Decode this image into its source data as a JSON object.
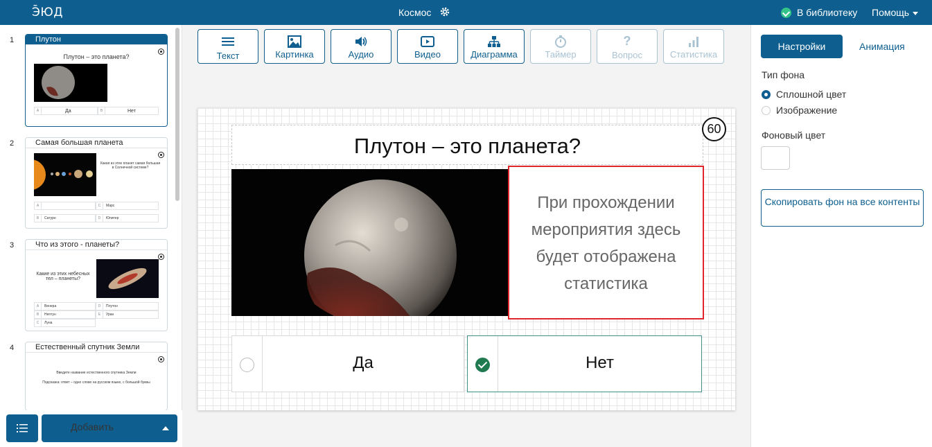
{
  "topbar": {
    "logo": "Э̄ЮД",
    "title": "Космос",
    "library": "В библиотеку",
    "help": "Помощь"
  },
  "slides": [
    {
      "num": "1",
      "title": "Плутон",
      "question": "Плутон – это планета?",
      "answers": [
        {
          "l": "A",
          "t": "Да"
        },
        {
          "l": "B",
          "t": "Нет"
        }
      ]
    },
    {
      "num": "2",
      "title": "Самая большая планета",
      "question": "Какая из этих планет самая большая в Солнечной системе?",
      "answers": [
        {
          "l": "A",
          "t": ""
        },
        {
          "l": "C",
          "t": "Марс"
        },
        {
          "l": "B",
          "t": "Сатурн"
        },
        {
          "l": "D",
          "t": "Юпитер"
        }
      ]
    },
    {
      "num": "3",
      "title": "Что из этого - планеты?",
      "question": "Какие из этих небесных тел – планеты?",
      "answers": [
        {
          "l": "A",
          "t": "Венера"
        },
        {
          "l": "D",
          "t": "Плутон"
        },
        {
          "l": "B",
          "t": "Нептун"
        },
        {
          "l": "E",
          "t": "Уран"
        },
        {
          "l": "C",
          "t": "Луна"
        }
      ]
    },
    {
      "num": "4",
      "title": "Естественный спутник Земли",
      "question": "Введите название естественного спутника Земли",
      "hint": "Подсказка: ответ – одно слово на русском языке, с большой буквы"
    }
  ],
  "left_bottom": {
    "add": "Добавить"
  },
  "toolbar": [
    {
      "icon": "text-icon",
      "label": "Текст",
      "enabled": true
    },
    {
      "icon": "image-icon",
      "label": "Картинка",
      "enabled": true
    },
    {
      "icon": "audio-icon",
      "label": "Аудио",
      "enabled": true
    },
    {
      "icon": "video-icon",
      "label": "Видео",
      "enabled": true
    },
    {
      "icon": "diagram-icon",
      "label": "Диаграмма",
      "enabled": true
    },
    {
      "icon": "timer-icon",
      "label": "Таймер",
      "enabled": false
    },
    {
      "icon": "question-icon",
      "label": "Вопрос",
      "enabled": false
    },
    {
      "icon": "stats-icon",
      "label": "Статистика",
      "enabled": false
    }
  ],
  "canvas": {
    "title": "Плутон – это планета?",
    "timer": "60",
    "stat_text": "При прохождении мероприятия здесь будет отображена статистика",
    "answers": [
      {
        "text": "Да",
        "correct": false
      },
      {
        "text": "Нет",
        "correct": true
      }
    ]
  },
  "settings": {
    "tab_settings": "Настройки",
    "tab_animation": "Анимация",
    "bg_type_label": "Тип фона",
    "options": [
      "Сплошной цвет",
      "Изображение"
    ],
    "selected_option": "Сплошной цвет",
    "bg_color_label": "Фоновый цвет",
    "bg_color": "#ffffff",
    "copy_button": "Скопировать фон на все контенты"
  },
  "colors": {
    "brand": "#0e5f8f",
    "highlight": "#e0262b",
    "correct": "#1f7a4f"
  }
}
